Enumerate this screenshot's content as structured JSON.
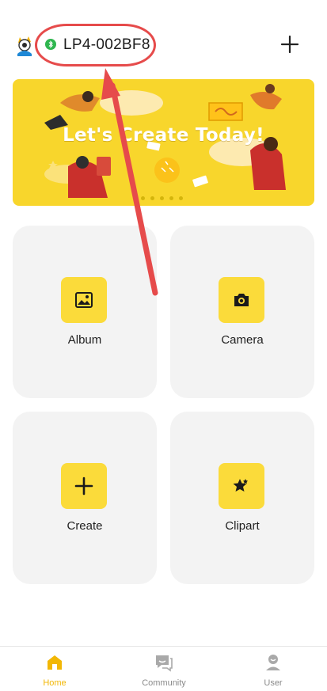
{
  "header": {
    "device_name": "LP4-002BF8",
    "add_label": "+"
  },
  "banner": {
    "title": "Let's Create Today!",
    "page_dots": 5
  },
  "tiles": [
    {
      "label": "Album",
      "icon": "image-icon"
    },
    {
      "label": "Camera",
      "icon": "camera-icon"
    },
    {
      "label": "Create",
      "icon": "plus-icon"
    },
    {
      "label": "Clipart",
      "icon": "star-icon"
    }
  ],
  "tabbar": {
    "items": [
      {
        "label": "Home",
        "icon": "home-icon",
        "active": true
      },
      {
        "label": "Community",
        "icon": "chat-icon",
        "active": false
      },
      {
        "label": "User",
        "icon": "user-icon",
        "active": false
      }
    ]
  },
  "colors": {
    "accent": "#fbdb3a",
    "active_tab": "#f2b705",
    "annotation": "#e64b4b",
    "bluetooth": "#2fb64f"
  }
}
